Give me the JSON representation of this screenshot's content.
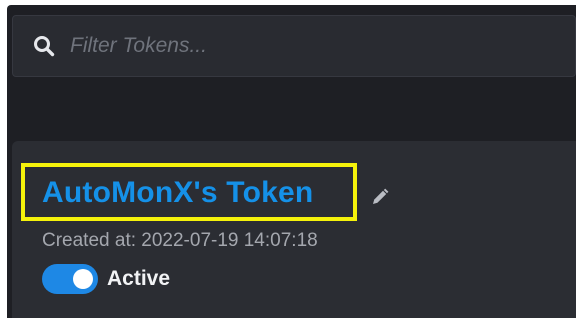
{
  "search": {
    "placeholder": "Filter Tokens...",
    "icon": "search-icon"
  },
  "token": {
    "name": "AutoMonX's Token",
    "created_label": "Created at: 2022-07-19 14:07:18",
    "status_label": "Active",
    "active": true,
    "edit_icon": "pencil-icon"
  },
  "colors": {
    "background": "#1e1f24",
    "card": "#2b2d33",
    "title": "#1591e8",
    "highlight": "#f5f20b",
    "toggle_on": "#1e88e5"
  }
}
